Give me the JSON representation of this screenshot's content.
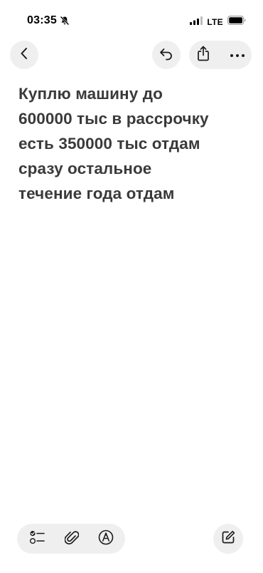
{
  "status_bar": {
    "time": "03:35",
    "network": "LTE",
    "icons": [
      "bell-slash-icon",
      "signal-bars-icon",
      "battery-icon"
    ]
  },
  "toolbar": {
    "back_icon": "chevron-left-icon",
    "undo_icon": "undo-arrow-icon",
    "share_icon": "share-icon",
    "more_icon": "ellipsis-icon"
  },
  "note": {
    "lines": [
      "Куплю машину до",
      "600000 тыс в рассрочку",
      "есть 350000 тыс отдам",
      "сразу остальное",
      "течение года отдам"
    ]
  },
  "bottom_toolbar": {
    "checklist_icon": "checklist-icon",
    "attachment_icon": "paperclip-icon",
    "markup_icon": "markup-pen-icon",
    "compose_icon": "compose-icon"
  },
  "colors": {
    "background": "#ffffff",
    "button_fill": "#efeff0",
    "text": "#3a3a3c",
    "icon": "#1c1c1e"
  }
}
